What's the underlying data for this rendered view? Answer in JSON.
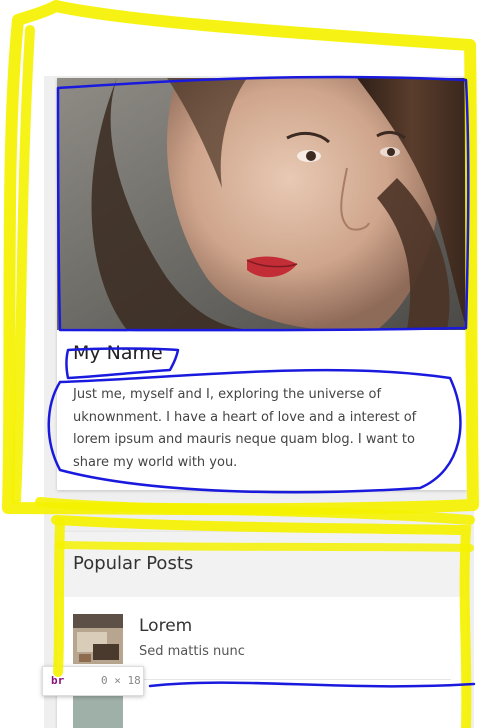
{
  "profile": {
    "name": "My Name",
    "bio": "Just me, myself and I, exploring the universe of uknownment. I have a heart of love and a interest of lorem ipsum and mauris neque quam blog. I want to share my world with you."
  },
  "popular_posts": {
    "title": "Popular Posts",
    "items": [
      {
        "title": "Lorem",
        "excerpt": "Sed mattis nunc"
      }
    ]
  },
  "devtools_badge": {
    "tag": "br",
    "size": "0 × 18"
  },
  "colors": {
    "highlight_yellow": "#f5f200",
    "annotation_blue": "#1a1adf",
    "tag_purple": "#881280"
  }
}
